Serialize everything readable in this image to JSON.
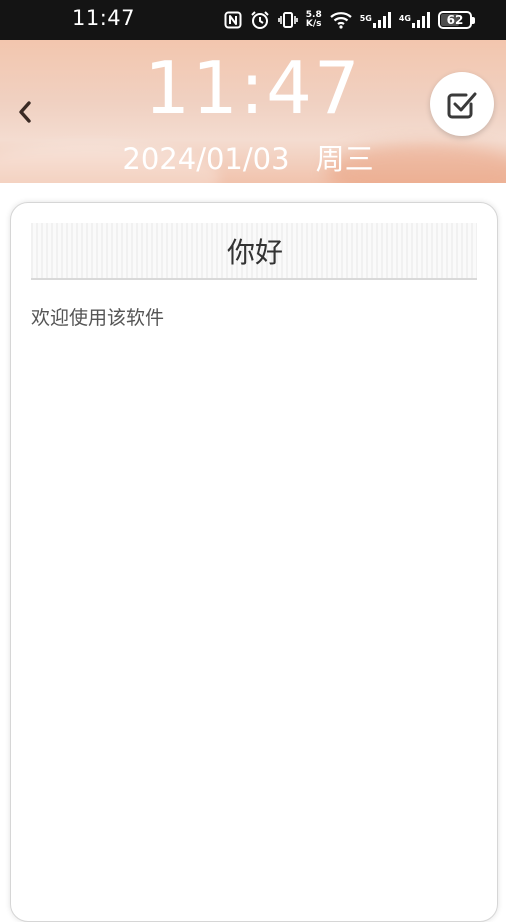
{
  "status_bar": {
    "time": "11:47",
    "net_speed_value": "5.8",
    "net_speed_unit": "K/s",
    "sim1_label": "5G",
    "sim2_label": "4G",
    "battery": "62"
  },
  "header": {
    "clock": "11:47",
    "date": "2024/01/03",
    "weekday": "周三"
  },
  "note": {
    "title": "你好",
    "body": "欢迎使用该软件"
  },
  "colors": {
    "status_bar_bg": "#141414",
    "header_bg": "#f0d1c2",
    "text_dark": "#333333"
  },
  "icons": {
    "back": "chevron-left-icon",
    "done": "check-square-icon",
    "nfc": "nfc-icon",
    "alarm": "alarm-icon",
    "vibrate": "vibrate-icon",
    "wifi": "wifi-icon",
    "signal": "signal-icon",
    "battery": "battery-icon"
  }
}
